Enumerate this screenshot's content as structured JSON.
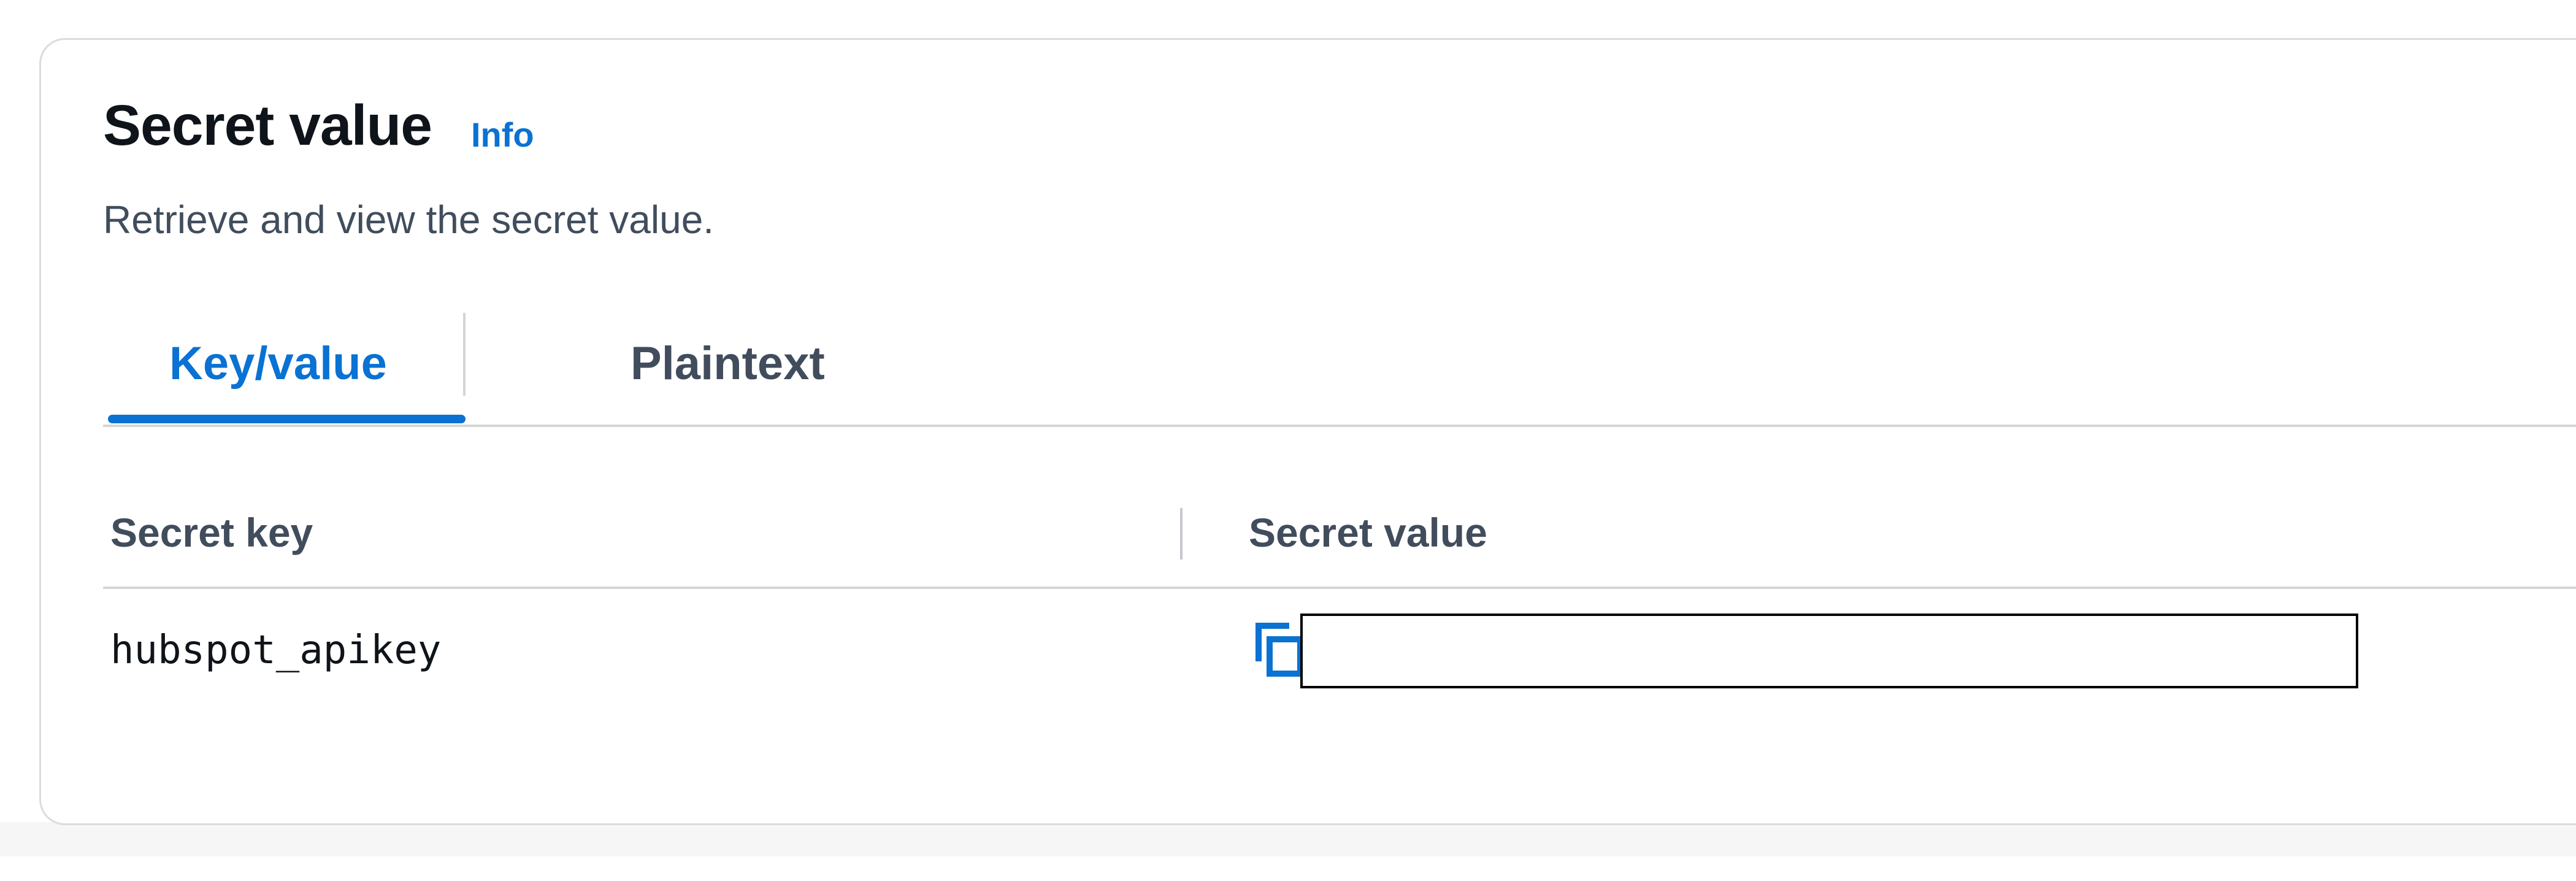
{
  "panel": {
    "title": "Secret value",
    "info_link": "Info",
    "description": "Retrieve and view the secret value."
  },
  "tabs": [
    {
      "label": "Key/value",
      "active": true
    },
    {
      "label": "Plaintext",
      "active": false
    }
  ],
  "table": {
    "columns": [
      "Secret key",
      "Secret value"
    ],
    "rows": [
      {
        "key": "hubspot_apikey",
        "value": ""
      }
    ]
  },
  "icons": {
    "copy": "copy-icon"
  },
  "colors": {
    "accent": "#0972d3",
    "title_text": "#0f141a",
    "secondary_text": "#414d5c",
    "border": "#d6d6d6"
  }
}
